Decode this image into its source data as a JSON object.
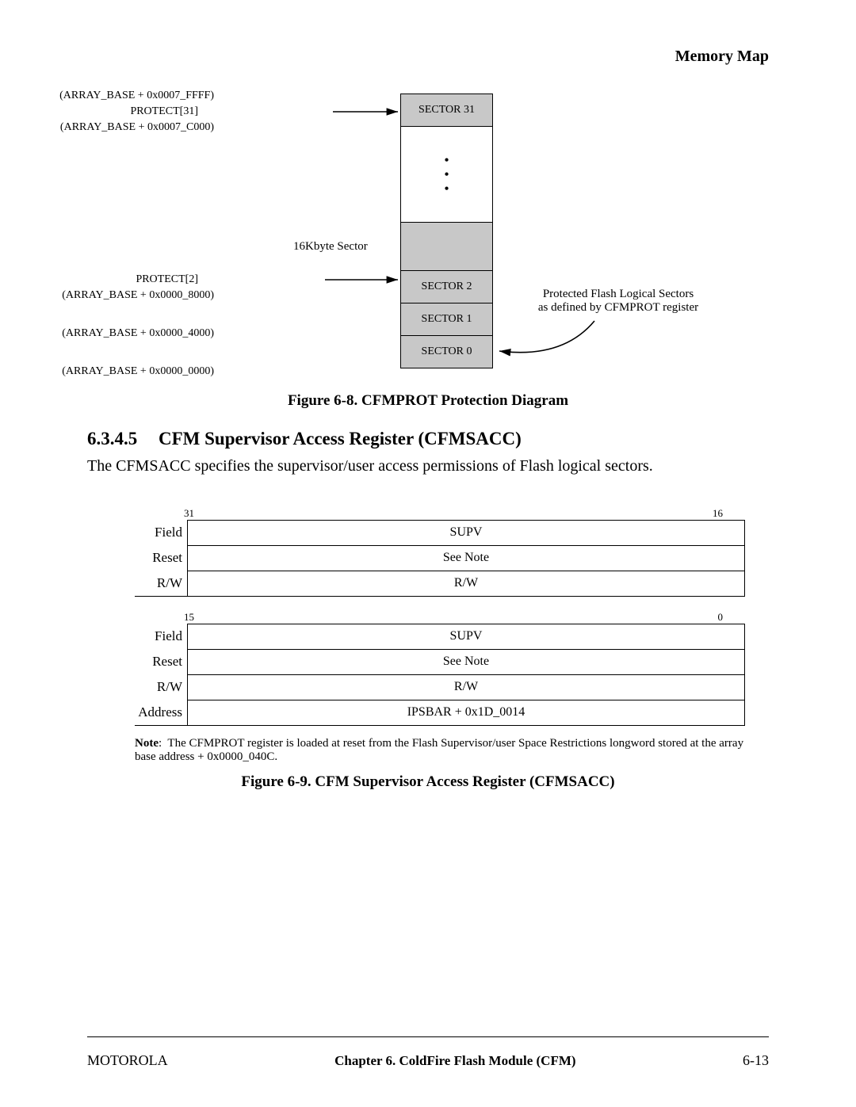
{
  "header": "Memory Map",
  "fig8": {
    "addr_top": "(ARRAY_BASE + 0x0007_FFFF)",
    "protect31": "PROTECT[31]",
    "addr_c000": "(ARRAY_BASE + 0x0007_C000)",
    "sector31": "SECTOR 31",
    "k16": "16Kbyte Sector",
    "protect2": "PROTECT[2]",
    "addr_8000": "(ARRAY_BASE + 0x0000_8000)",
    "sector2": "SECTOR 2",
    "sector1": "SECTOR 1",
    "addr_4000": "(ARRAY_BASE + 0x0000_4000)",
    "sector0": "SECTOR 0",
    "addr_0000": "(ARRAY_BASE + 0x0000_0000)",
    "annot_l1": "Protected Flash Logical Sectors",
    "annot_l2": "as defined by CFMPROT register",
    "caption": "Figure 6-8. CFMPROT Protection Diagram"
  },
  "section": {
    "num": "6.3.4.5",
    "title": "CFM Supervisor Access Register (CFMSACC)",
    "body": "The CFMSACC specifies the supervisor/user access permissions of Flash logical sectors."
  },
  "reg": {
    "bit_hi_l": "31",
    "bit_hi_r": "16",
    "bit_lo_l": "15",
    "bit_lo_r": "0",
    "field_label": "Field",
    "reset_label": "Reset",
    "rw_label": "R/W",
    "addr_label": "Address",
    "supv": "SUPV",
    "seenote": "See Note",
    "rw": "R/W",
    "addr": "IPSBAR + 0x1D_0014",
    "note": "The CFMPROT register is loaded at reset from the Flash Supervisor/user Space Restrictions longword stored at the array base address + 0x0000_040C.",
    "note_prefix": "Note",
    "caption": "Figure 6-9. CFM Supervisor Access Register (CFMSACC)"
  },
  "footer": {
    "left": "MOTOROLA",
    "center": "Chapter 6.  ColdFire Flash Module (CFM)",
    "right": "6-13"
  }
}
